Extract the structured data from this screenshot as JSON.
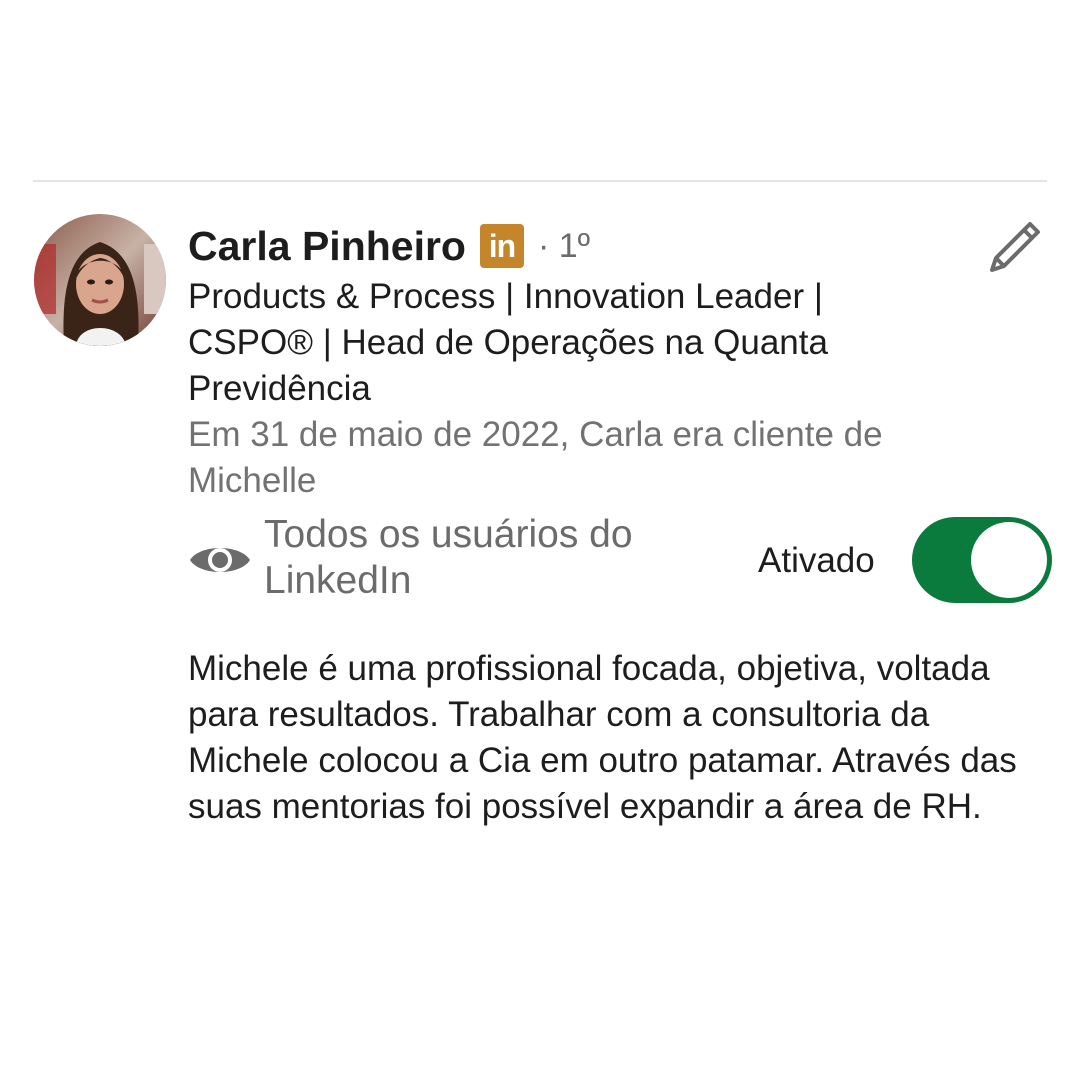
{
  "recommendation": {
    "author_name": "Carla Pinheiro",
    "badge_text": "in",
    "badge_icon": "linkedin-icon",
    "badge_color": "#c5852a",
    "connection_degree": "· 1º",
    "headline": "Products & Process | Innovation Leader | CSPO® | Head de Operações na Quanta Previdência",
    "relationship": "Em 31 de maio de 2022, Carla era cliente de Michelle",
    "edit_icon": "pencil-icon",
    "visibility": {
      "icon": "eye-icon",
      "label": "Todos os usuários do LinkedIn",
      "toggle_label": "Ativado",
      "toggle_on": true,
      "toggle_color": "#0a7a3d"
    },
    "text": "Michele é uma profissional focada, objetiva, voltada para resultados. Trabalhar com a consultoria da Michele colocou a Cia em outro patamar. Através das suas mentorias foi possível expandir a área de RH."
  }
}
